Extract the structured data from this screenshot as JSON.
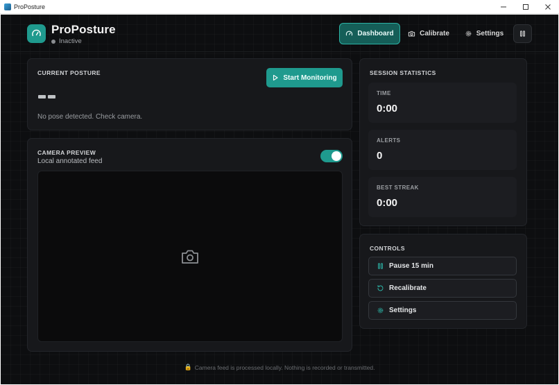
{
  "window": {
    "title": "ProPosture"
  },
  "header": {
    "app_name": "ProPosture",
    "status_text": "Inactive",
    "nav": {
      "dashboard": "Dashboard",
      "calibrate": "Calibrate",
      "settings": "Settings"
    }
  },
  "posture_card": {
    "title": "CURRENT POSTURE",
    "start_button": "Start Monitoring",
    "message": "No pose detected. Check camera."
  },
  "camera_card": {
    "title": "CAMERA PREVIEW",
    "subtitle": "Local annotated feed",
    "toggle_on": true
  },
  "stats_card": {
    "title": "SESSION STATISTICS",
    "stats": [
      {
        "label": "TIME",
        "value": "0:00"
      },
      {
        "label": "ALERTS",
        "value": "0"
      },
      {
        "label": "BEST STREAK",
        "value": "0:00"
      }
    ]
  },
  "controls_card": {
    "title": "CONTROLS",
    "buttons": [
      {
        "label": "Pause 15 min",
        "icon": "pause-icon"
      },
      {
        "label": "Recalibrate",
        "icon": "refresh-icon"
      },
      {
        "label": "Settings",
        "icon": "gear-icon"
      }
    ]
  },
  "footer": {
    "text": "Camera feed is processed locally. Nothing is recorded or transmitted."
  },
  "colors": {
    "accent": "#1f9a8e",
    "background": "#0d0e10",
    "card": "#17181b"
  }
}
